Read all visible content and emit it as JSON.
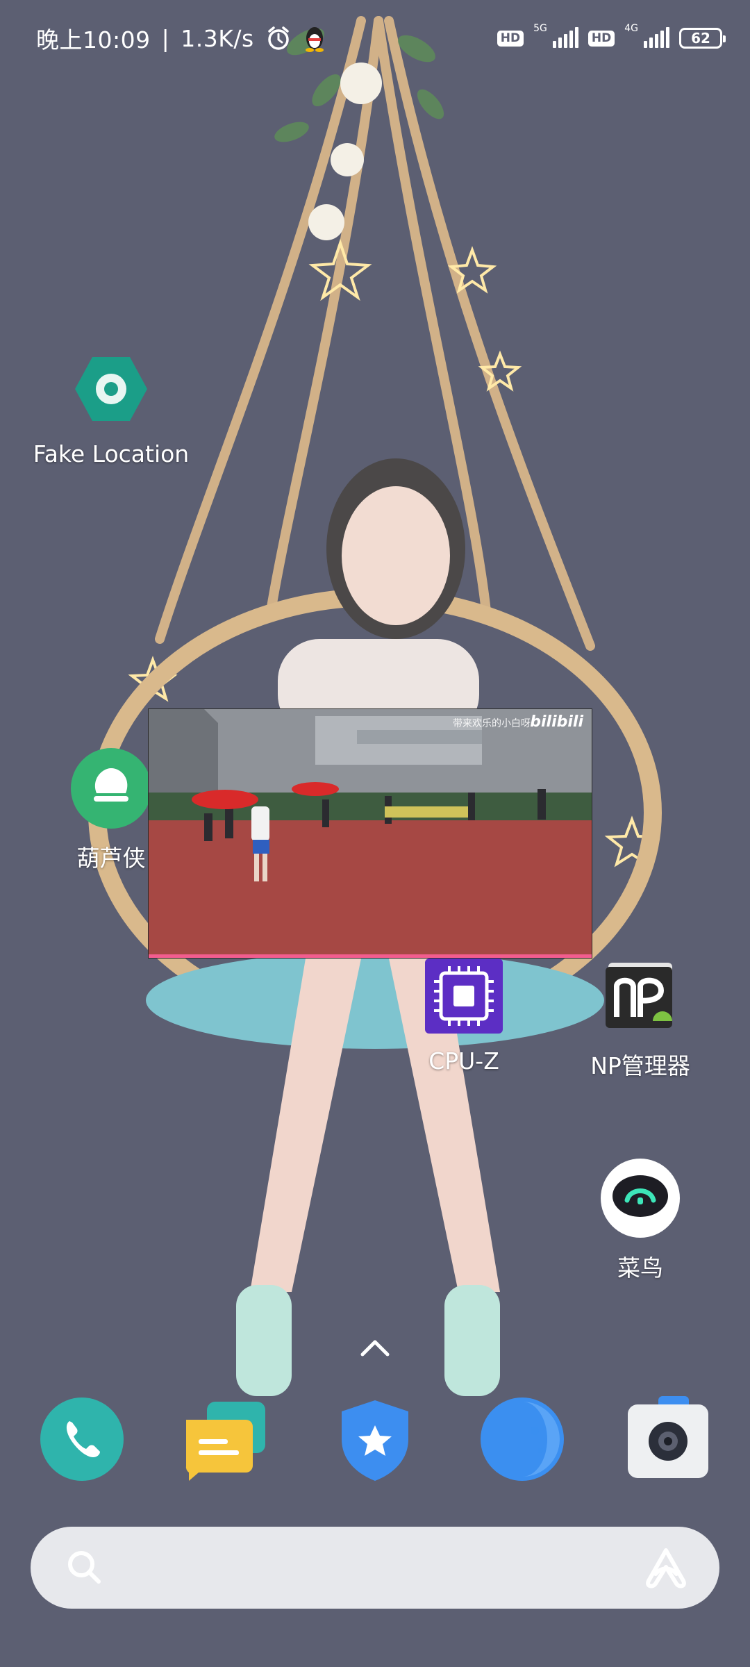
{
  "status_bar": {
    "time": "晚上10:09",
    "separator": "|",
    "net_speed": "1.3K/s",
    "icons": [
      "alarm-icon",
      "qq-penguin-icon"
    ],
    "hd1": "HD",
    "net1": "5G",
    "hd2": "HD",
    "net2": "4G",
    "battery": "62"
  },
  "apps": [
    {
      "label": "Fake Location",
      "icon": "fake-location-icon",
      "color": "#1b9e88"
    },
    {
      "label": "葫芦侠",
      "icon": "huluxia-icon",
      "color": "#35b472"
    },
    {
      "label": "CPU-Z",
      "icon": "cpu-chip-icon",
      "color": "#5c2ec4"
    },
    {
      "label": "NP管理器",
      "icon": "np-manager-icon",
      "color": "#2a2a2a"
    },
    {
      "label": "菜鸟",
      "icon": "cainiao-robot-icon",
      "color": "#ffffff"
    }
  ],
  "floating_video": {
    "uploader": "带来欢乐的小白呀",
    "logo": "bilibili",
    "progress": 1.0,
    "progress_color": "#f25d8e"
  },
  "dock": [
    {
      "icon": "phone-icon",
      "color": "#2fb4ac"
    },
    {
      "icon": "messages-icon",
      "color": "#f6c53b"
    },
    {
      "icon": "security-shield-icon",
      "color": "#3d8ef0"
    },
    {
      "icon": "browser-moon-icon",
      "color": "#3b8ff0"
    },
    {
      "icon": "camera-icon",
      "color": "#eef0f2"
    }
  ],
  "search": {
    "placeholder": ""
  }
}
